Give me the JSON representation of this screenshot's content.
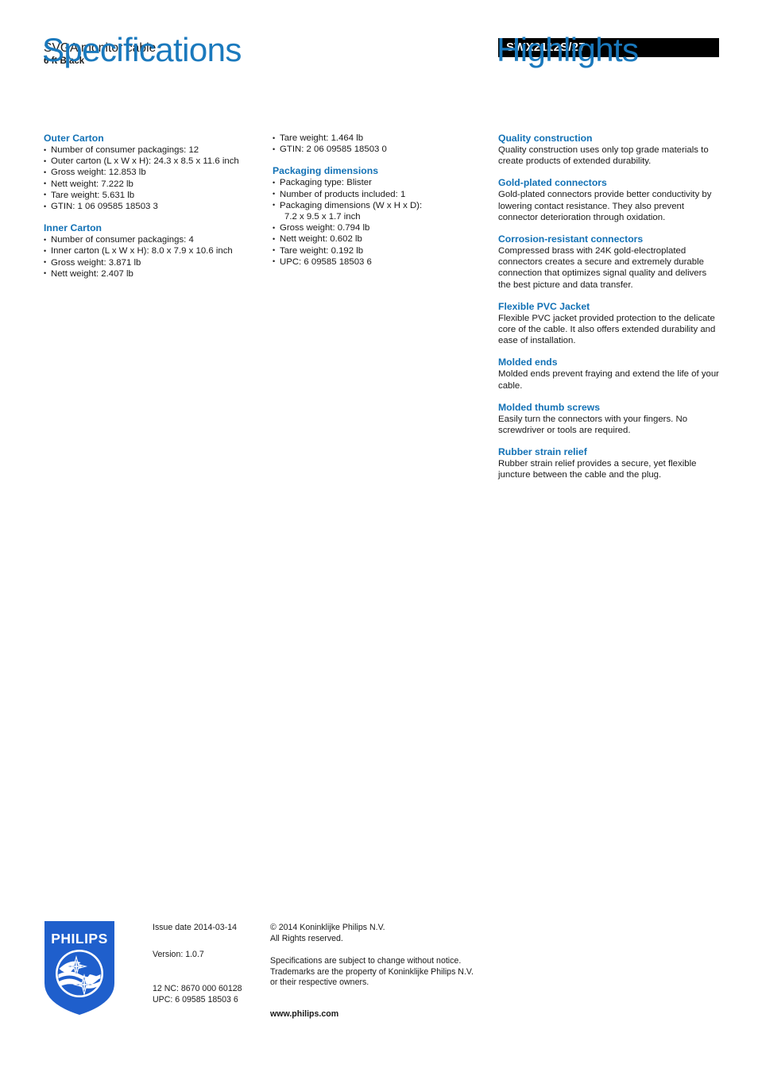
{
  "header": {
    "product_name": "SVGA monitor cable",
    "product_variant": "6 ft Black",
    "product_code": "SWX2112S/27",
    "left_title": "Specifications",
    "right_title": "Highlights"
  },
  "colors": {
    "heading_blue": "#1271b5",
    "title_blue": "#1a79bd",
    "code_bar_bg": "#000000",
    "logo_blue": "#1f5fcc"
  },
  "specifications": {
    "column1": [
      {
        "heading": "Outer Carton",
        "items": [
          "Number of consumer packagings: 12",
          "Outer carton (L x W x H): 24.3 x 8.5 x 11.6 inch",
          "Gross weight: 12.853 lb",
          "Nett weight: 7.222 lb",
          "Tare weight: 5.631 lb",
          "GTIN: 1 06 09585 18503 3"
        ]
      },
      {
        "heading": "Inner Carton",
        "items": [
          "Number of consumer packagings: 4",
          "Inner carton (L x W x H): 8.0 x 7.9 x 10.6 inch",
          "Gross weight: 3.871 lb",
          "Nett weight: 2.407 lb"
        ]
      }
    ],
    "column2": [
      {
        "heading": "",
        "items": [
          "Tare weight: 1.464 lb",
          "GTIN: 2 06 09585 18503 0"
        ]
      },
      {
        "heading": "Packaging dimensions",
        "items": [
          "Packaging type: Blister",
          "Number of products included: 1",
          "Packaging dimensions (W x H x D):",
          "7.2 x 9.5 x 1.7 inch",
          "Gross weight: 0.794 lb",
          "Nett weight: 0.602 lb",
          "Tare weight: 0.192 lb",
          "UPC: 6 09585 18503 6"
        ]
      }
    ]
  },
  "highlights": [
    {
      "title": "Quality construction",
      "body": "Quality construction uses only top grade materials to create products of extended durability."
    },
    {
      "title": "Gold-plated connectors",
      "body": "Gold-plated connectors provide better conductivity by lowering contact resistance. They also prevent connector deterioration through oxidation."
    },
    {
      "title": "Corrosion-resistant connectors",
      "body": "Compressed brass with 24K gold-electroplated connectors creates a secure and extremely durable connection that optimizes signal quality and delivers the best picture and data transfer."
    },
    {
      "title": "Flexible PVC Jacket",
      "body": "Flexible PVC jacket provided protection to the delicate core of the cable. It also offers extended durability and ease of installation."
    },
    {
      "title": "Molded ends",
      "body": "Molded ends prevent fraying and extend the life of your cable."
    },
    {
      "title": "Molded thumb screws",
      "body": "Easily turn the connectors with your fingers. No screwdriver or tools are required."
    },
    {
      "title": "Rubber strain relief",
      "body": "Rubber strain relief provides a secure, yet flexible juncture between the cable and the plug."
    }
  ],
  "footer": {
    "logo_wordmark": "PHILIPS",
    "issue_date": "Issue date 2014-03-14",
    "version": "Version: 1.0.7",
    "nc_code": "12 NC: 8670 000 60128",
    "upc_code": "UPC: 6 09585 18503 6",
    "copyright_line1": "© 2014 Koninklijke Philips N.V.",
    "copyright_line2": "All Rights reserved.",
    "disclaimer_line1": "Specifications are subject to change without notice.",
    "disclaimer_line2": "Trademarks are the property of Koninklijke Philips N.V.",
    "disclaimer_line3": "or their respective owners.",
    "website": "www.philips.com"
  }
}
